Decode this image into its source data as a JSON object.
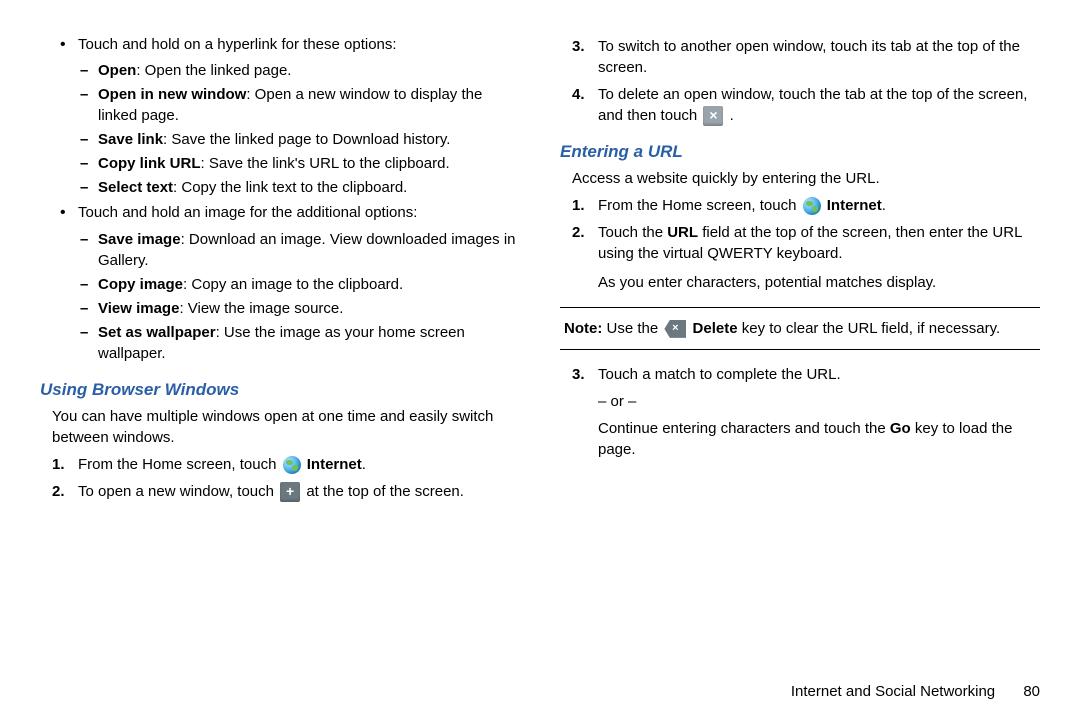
{
  "left": {
    "hyper_intro": "Touch and hold on a hyperlink for these options:",
    "hyper": [
      {
        "t": "Open",
        "d": ": Open the linked page."
      },
      {
        "t": "Open in new window",
        "d": ": Open a new window to display the linked page."
      },
      {
        "t": "Save link",
        "d": ": Save the linked page to Download history."
      },
      {
        "t": "Copy link URL",
        "d": ": Save the link's URL to the clipboard."
      },
      {
        "t": "Select text",
        "d": ": Copy the link text to the clipboard."
      }
    ],
    "img_intro": "Touch and hold an image for the additional options:",
    "img": [
      {
        "t": "Save image",
        "d": ": Download an image. View downloaded images in Gallery."
      },
      {
        "t": "Copy image",
        "d": ": Copy an image to the clipboard."
      },
      {
        "t": "View image",
        "d": ": View the image source."
      },
      {
        "t": "Set as wallpaper",
        "d": ": Use the image as your home screen wallpaper."
      }
    ],
    "h1": "Using Browser Windows",
    "h1_intro": "You can have multiple windows open at one time and easily switch between windows.",
    "s1_pre": "From the Home screen, touch ",
    "s1_post": " Internet",
    "s1_end": ".",
    "s2_pre": "To open a new window, touch ",
    "s2_post": " at the top of the screen."
  },
  "right": {
    "s3": "To switch to another open window, touch its tab at the top of the screen.",
    "s4_pre": "To delete an open window, touch the tab at the top of the screen, and then touch ",
    "s4_post": ".",
    "h2": "Entering a URL",
    "h2_intro": "Access a website quickly by entering the URL.",
    "e1_pre": "From the Home screen, touch ",
    "e1_post": " Internet",
    "e1_end": ".",
    "e2_a": "Touch the ",
    "e2_b": "URL",
    "e2_c": " field at the top of the screen, then enter the URL using the virtual QWERTY keyboard.",
    "e2_extra": "As you enter characters, potential matches display.",
    "note_a": "Note:",
    "note_b": " Use the ",
    "note_c": " Delete",
    "note_d": " key to clear the URL field, if necessary.",
    "e3_a": "Touch a match to complete the URL.",
    "e3_or": "– or –",
    "e3_b_pre": "Continue entering characters and touch the ",
    "e3_b_key": "Go",
    "e3_b_post": " key to load the page."
  },
  "footer": {
    "section": "Internet and Social Networking",
    "page": "80"
  }
}
